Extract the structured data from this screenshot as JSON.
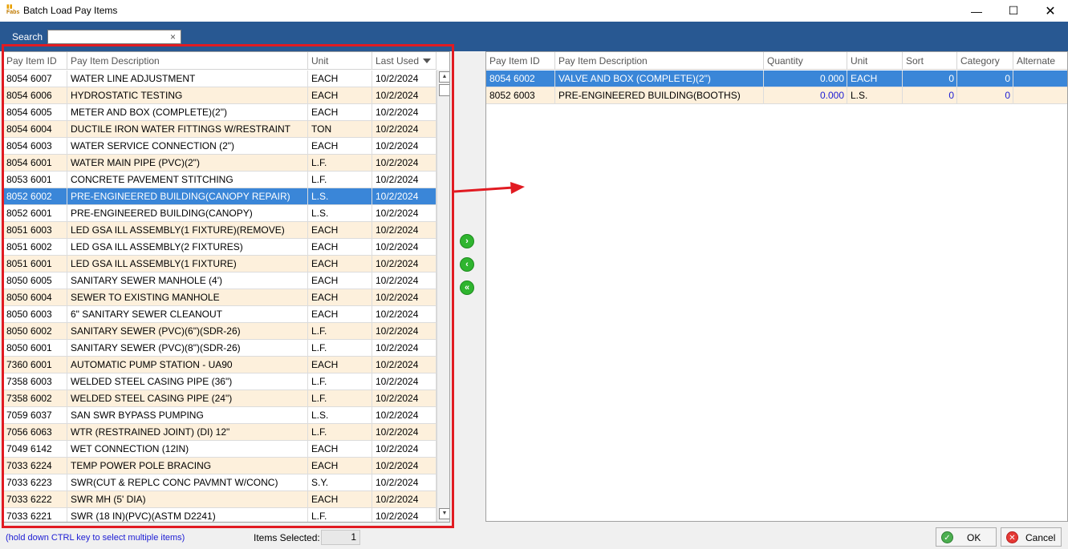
{
  "window": {
    "title": "Batch Load Pay Items",
    "app_logo_text": "Fabs"
  },
  "search": {
    "label": "Search",
    "value": "",
    "clear_glyph": "×"
  },
  "left_grid": {
    "columns": [
      "Pay Item ID",
      "Pay Item Description",
      "Unit",
      "Last Used"
    ],
    "rows": [
      {
        "id": "8054 6007",
        "desc": "WATER LINE ADJUSTMENT",
        "unit": "EACH",
        "last": "10/2/2024"
      },
      {
        "id": "8054 6006",
        "desc": "HYDROSTATIC TESTING",
        "unit": "EACH",
        "last": "10/2/2024"
      },
      {
        "id": "8054 6005",
        "desc": "METER AND BOX (COMPLETE)(2\")",
        "unit": "EACH",
        "last": "10/2/2024"
      },
      {
        "id": "8054 6004",
        "desc": "DUCTILE IRON WATER FITTINGS W/RESTRAINT",
        "unit": "TON",
        "last": "10/2/2024"
      },
      {
        "id": "8054 6003",
        "desc": "WATER SERVICE CONNECTION (2\")",
        "unit": "EACH",
        "last": "10/2/2024"
      },
      {
        "id": "8054 6001",
        "desc": "WATER MAIN PIPE (PVC)(2\")",
        "unit": "L.F.",
        "last": "10/2/2024"
      },
      {
        "id": "8053 6001",
        "desc": "CONCRETE PAVEMENT STITCHING",
        "unit": "L.F.",
        "last": "10/2/2024"
      },
      {
        "id": "8052 6002",
        "desc": "PRE-ENGINEERED BUILDING(CANOPY REPAIR)",
        "unit": "L.S.",
        "last": "10/2/2024"
      },
      {
        "id": "8052 6001",
        "desc": "PRE-ENGINEERED BUILDING(CANOPY)",
        "unit": "L.S.",
        "last": "10/2/2024"
      },
      {
        "id": "8051 6003",
        "desc": "LED GSA ILL ASSEMBLY(1 FIXTURE)(REMOVE)",
        "unit": "EACH",
        "last": "10/2/2024"
      },
      {
        "id": "8051 6002",
        "desc": "LED GSA ILL ASSEMBLY(2 FIXTURES)",
        "unit": "EACH",
        "last": "10/2/2024"
      },
      {
        "id": "8051 6001",
        "desc": "LED GSA ILL ASSEMBLY(1 FIXTURE)",
        "unit": "EACH",
        "last": "10/2/2024"
      },
      {
        "id": "8050 6005",
        "desc": "SANITARY SEWER MANHOLE (4')",
        "unit": "EACH",
        "last": "10/2/2024"
      },
      {
        "id": "8050 6004",
        "desc": "SEWER TO EXISTING MANHOLE",
        "unit": "EACH",
        "last": "10/2/2024"
      },
      {
        "id": "8050 6003",
        "desc": "6\" SANITARY SEWER CLEANOUT",
        "unit": "EACH",
        "last": "10/2/2024"
      },
      {
        "id": "8050 6002",
        "desc": "SANITARY SEWER (PVC)(6\")(SDR-26)",
        "unit": "L.F.",
        "last": "10/2/2024"
      },
      {
        "id": "8050 6001",
        "desc": "SANITARY SEWER (PVC)(8\")(SDR-26)",
        "unit": "L.F.",
        "last": "10/2/2024"
      },
      {
        "id": "7360 6001",
        "desc": "AUTOMATIC PUMP STATION - UA90",
        "unit": "EACH",
        "last": "10/2/2024"
      },
      {
        "id": "7358 6003",
        "desc": "WELDED STEEL CASING PIPE (36\")",
        "unit": "L.F.",
        "last": "10/2/2024"
      },
      {
        "id": "7358 6002",
        "desc": "WELDED STEEL CASING PIPE (24\")",
        "unit": "L.F.",
        "last": "10/2/2024"
      },
      {
        "id": "7059 6037",
        "desc": "SAN SWR BYPASS PUMPING",
        "unit": "L.S.",
        "last": "10/2/2024"
      },
      {
        "id": "7056 6063",
        "desc": "WTR (RESTRAINED JOINT) (DI) 12\"",
        "unit": "L.F.",
        "last": "10/2/2024"
      },
      {
        "id": "7049 6142",
        "desc": "WET CONNECTION (12IN)",
        "unit": "EACH",
        "last": "10/2/2024"
      },
      {
        "id": "7033 6224",
        "desc": "TEMP POWER POLE BRACING",
        "unit": "EACH",
        "last": "10/2/2024"
      },
      {
        "id": "7033 6223",
        "desc": "SWR(CUT & REPLC CONC PAVMNT W/CONC)",
        "unit": "S.Y.",
        "last": "10/2/2024"
      },
      {
        "id": "7033 6222",
        "desc": "SWR MH (5' DIA)",
        "unit": "EACH",
        "last": "10/2/2024"
      },
      {
        "id": "7033 6221",
        "desc": "SWR (18 IN)(PVC)(ASTM D2241)",
        "unit": "L.F.",
        "last": "10/2/2024"
      }
    ],
    "selected_index": 7
  },
  "right_grid": {
    "columns": [
      "Pay Item ID",
      "Pay Item Description",
      "Quantity",
      "Unit",
      "Sort",
      "Category",
      "Alternate"
    ],
    "rows": [
      {
        "id": "8054 6002",
        "desc": "VALVE AND BOX (COMPLETE)(2\")",
        "qty": "0.000",
        "unit": "EACH",
        "sort": "0",
        "category": "0",
        "alternate": ""
      },
      {
        "id": "8052 6003",
        "desc": "PRE-ENGINEERED BUILDING(BOOTHS)",
        "qty": "0.000",
        "unit": "L.S.",
        "sort": "0",
        "category": "0",
        "alternate": ""
      }
    ],
    "selected_index": 0
  },
  "move_buttons": {
    "add_glyph": "›",
    "remove_glyph": "‹",
    "remove_all_glyph": "«"
  },
  "footer": {
    "hint": "(hold down CTRL key to select multiple items)",
    "items_selected_label": "Items Selected:",
    "items_selected_value": "1",
    "ok_label": "OK",
    "cancel_label": "Cancel"
  },
  "icons": {
    "ok": "check-circle-icon",
    "cancel": "x-circle-icon",
    "add": "arrow-right-circle-icon",
    "remove": "arrow-left-circle-icon",
    "remove_all": "double-arrow-left-circle-icon"
  },
  "colors": {
    "header_bar": "#285892",
    "selection": "#3a86d8",
    "alt_row": "#fdf0dc",
    "highlight": "#e11b22",
    "button_green": "#2fb52f"
  }
}
